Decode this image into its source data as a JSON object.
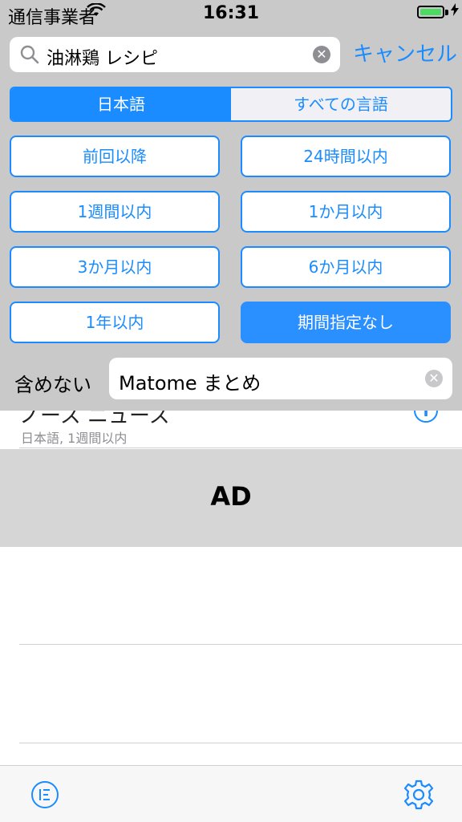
{
  "status_bar": {
    "carrier": "通信事業者",
    "time": "16:31"
  },
  "search": {
    "query": "油淋鶏 レシピ",
    "cancel_label": "キャンセル"
  },
  "language_segment": {
    "options": [
      "日本語",
      "すべての言語"
    ],
    "selected": "日本語"
  },
  "period_buttons": {
    "items": [
      "前回以降",
      "24時間以内",
      "1週間以内",
      "1か月以内",
      "3か月以内",
      "6か月以内",
      "1年以内",
      "期間指定なし"
    ],
    "selected": "期間指定なし"
  },
  "exclude": {
    "label": "含めない",
    "value": "Matome まとめ"
  },
  "list": {
    "row_title": "ノース ニュース",
    "row_subtitle": "日本語, 1週間以内"
  },
  "ad": {
    "label": "AD"
  },
  "colors": {
    "accent": "#1a8cff",
    "panel_bg": "#c9c9c9",
    "ad_bg": "#d6d6d6"
  },
  "icons": {
    "search": "search-icon",
    "clear": "clear-icon",
    "info": "info-icon",
    "list": "list-icon",
    "settings": "gear-icon"
  }
}
